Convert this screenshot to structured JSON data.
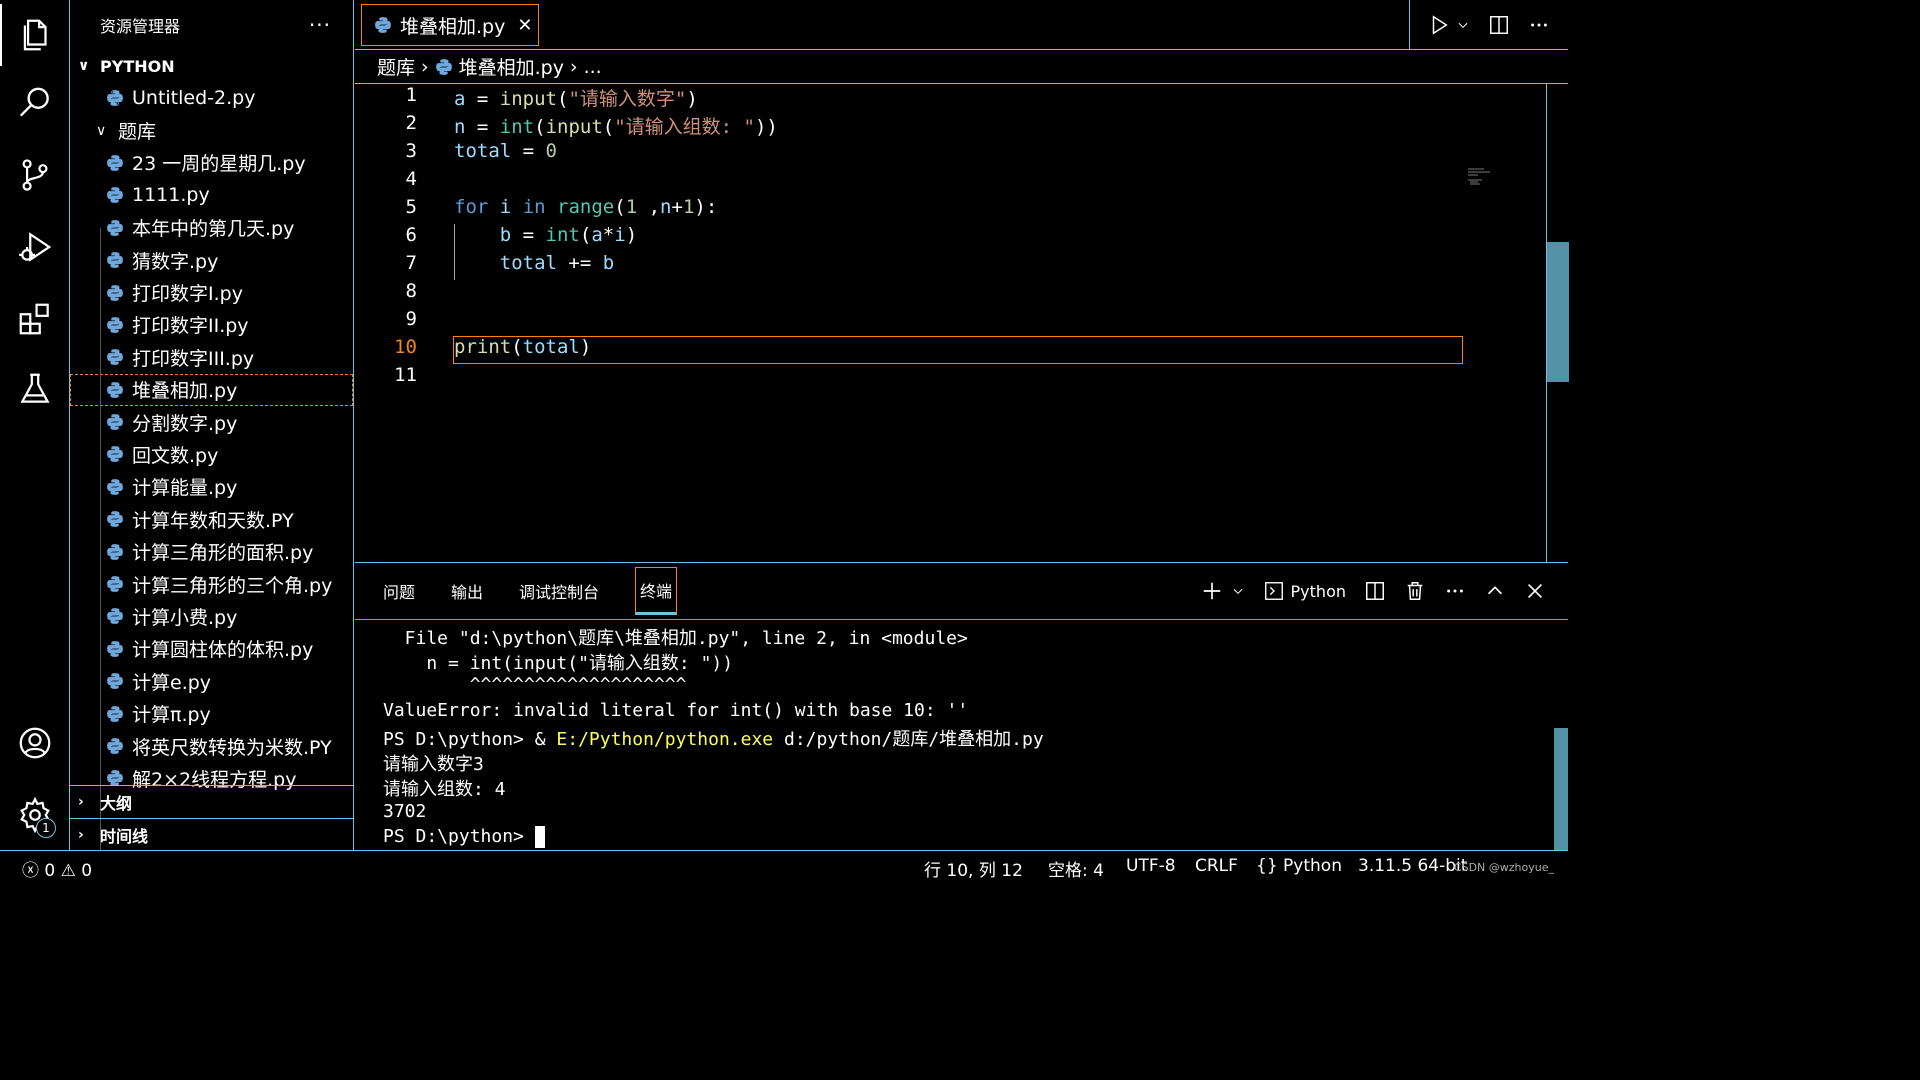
{
  "sidebar": {
    "title": "资源管理器",
    "more": "···",
    "root": "PYTHON",
    "top_file": "Untitled-2.py",
    "folder": "题库",
    "files": [
      "23 一周的星期几.py",
      "1111.py",
      "本年中的第几天.py",
      "猜数字.py",
      "打印数字I.py",
      "打印数字II.py",
      "打印数字III.py",
      "堆叠相加.py",
      "分割数字.py",
      "回文数.py",
      "计算能量.py",
      "计算年数和天数.PY",
      "计算三角形的面积.py",
      "计算三角形的三个角.py",
      "计算小费.py",
      "计算圆柱体的体积.py",
      "计算e.py",
      "计算π.py",
      "将英尺数转换为米数.PY",
      "解2×2线程方程.py"
    ],
    "selected_index": 7,
    "outline": "大纲",
    "timeline": "时间线"
  },
  "activity": {
    "settings_badge": "1"
  },
  "editor": {
    "tab_label": "堆叠相加.py",
    "tab_close": "✕",
    "breadcrumb": {
      "folder": "题库",
      "file": "堆叠相加.py",
      "more": "..."
    },
    "line_numbers": [
      "1",
      "2",
      "3",
      "4",
      "5",
      "6",
      "7",
      "8",
      "9",
      "10",
      "11"
    ],
    "current_line": 10
  },
  "panel": {
    "tabs": [
      "问题",
      "输出",
      "调试控制台",
      "终端"
    ],
    "active_tab": "终端",
    "shell_label": "Python",
    "terminal": {
      "line1": "  File \"d:\\python\\题库\\堆叠相加.py\", line 2, in <module>",
      "line2": "    n = int(input(\"请输入组数: \"))",
      "line3": "        ^^^^^^^^^^^^^^^^^^^^",
      "line4": "ValueError: invalid literal for int() with base 10: ''",
      "line5_prefix": "PS D:\\python> & ",
      "line5_exe": "E:/Python/python.exe",
      "line5_suffix": " d:/python/题库/堆叠相加.py",
      "line6": "请输入数字3",
      "line7": "请输入组数: 4",
      "line8": "3702",
      "line9": "PS D:\\python> "
    }
  },
  "status": {
    "errors": "0",
    "warnings": "0",
    "position": "行 10, 列 12",
    "spaces": "空格: 4",
    "encoding": "UTF-8",
    "eol": "CRLF",
    "language": "Python",
    "interpreter": "3.11.5 64-bit",
    "watermark": "CSDN @wzhoyue_"
  }
}
